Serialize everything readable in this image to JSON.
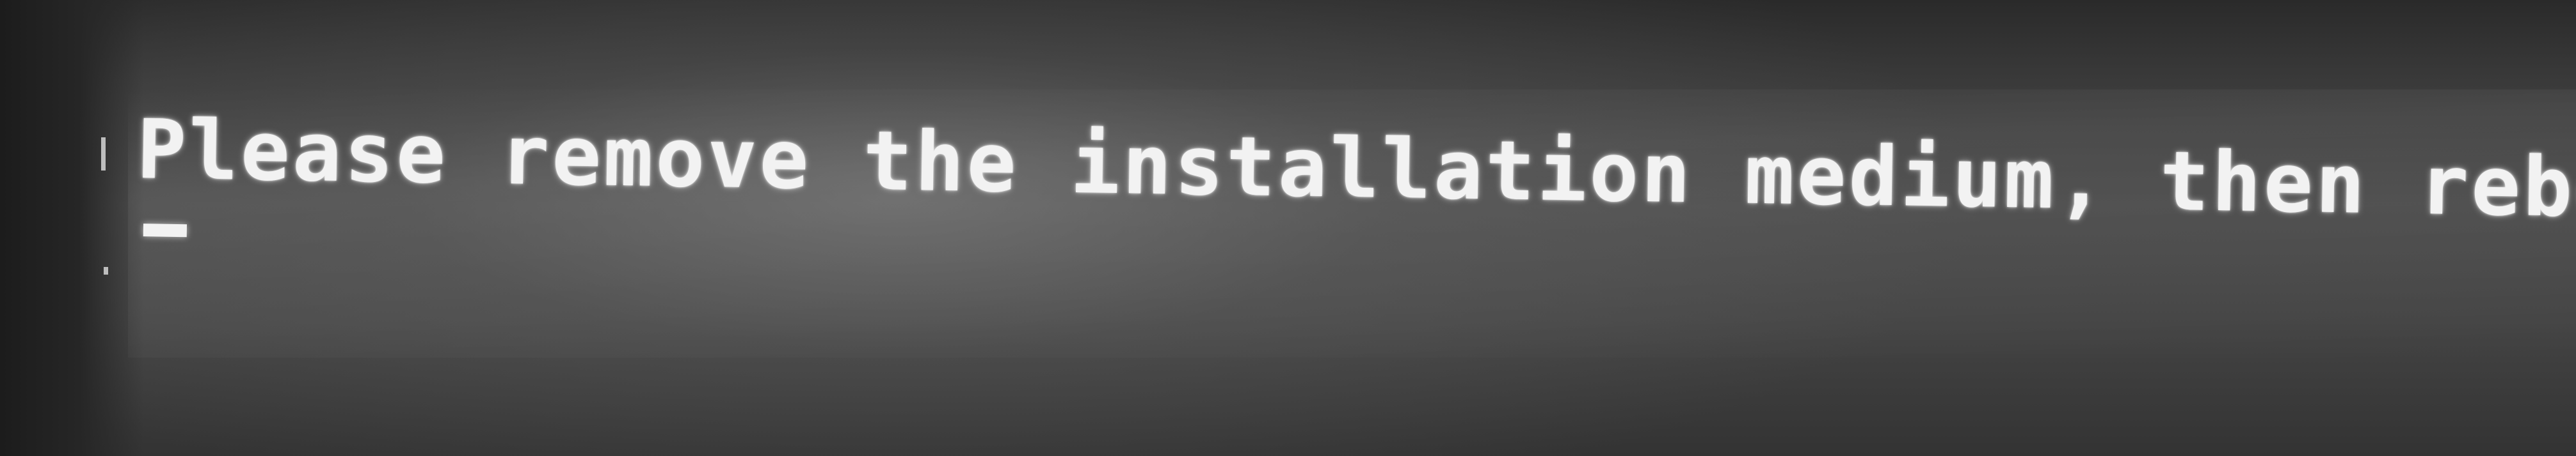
{
  "console": {
    "message": "Please remove the installation medium, then reboot."
  }
}
